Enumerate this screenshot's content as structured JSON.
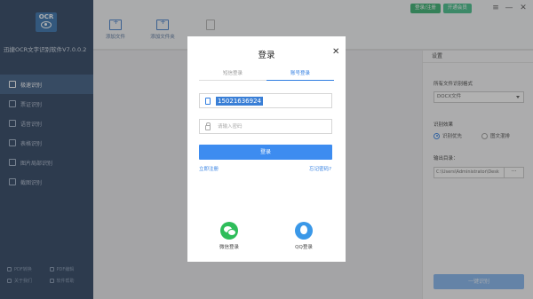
{
  "app": {
    "title": "迅捷OCR文字识别软件V7.0.0.2",
    "logo_text": "OCR"
  },
  "sidebar": {
    "items": [
      {
        "label": "极速识别",
        "active": true
      },
      {
        "label": "票证识别",
        "active": false
      },
      {
        "label": "语音识别",
        "active": false
      },
      {
        "label": "表格识别",
        "active": false
      },
      {
        "label": "图片局部识别",
        "active": false
      },
      {
        "label": "截图识别",
        "active": false
      }
    ],
    "bottom_links": [
      "PDF转换",
      "PDF编辑",
      "关于我们",
      "软件帮助"
    ]
  },
  "toolbar": {
    "add_file": "添加文件",
    "add_folder": "添加文件夹"
  },
  "top_right": {
    "login_register": "登录/注册",
    "open_vip": "开通会员",
    "controls": [
      "≡",
      "—",
      "✕"
    ]
  },
  "settings": {
    "header": "设置",
    "format_label": "所有文件识别格式",
    "format_value": "DOCX文件",
    "effect_label": "识别效果",
    "effect_options": [
      "识别优先",
      "图文混排"
    ],
    "effect_selected": 0,
    "output_label": "输出目录：",
    "output_path": "C:\\Users\\Administrator\\Desk",
    "browse_label": "···",
    "recognize_button": "一键识别"
  },
  "login_modal": {
    "title": "登录",
    "close": "✕",
    "tabs": [
      "短信登录",
      "账号登录"
    ],
    "active_tab": 1,
    "phone_value": "15021636924",
    "password_placeholder": "请输入密码",
    "login_button": "登录",
    "register_link": "立即注册",
    "forgot_link": "忘记密码?",
    "wechat_label": "微信登录",
    "qq_label": "QQ登录"
  },
  "colors": {
    "sidebar_bg": "#243b5a",
    "accent": "#3d8cf0",
    "wechat": "#2ebd5a",
    "qq": "#3a98e8"
  }
}
